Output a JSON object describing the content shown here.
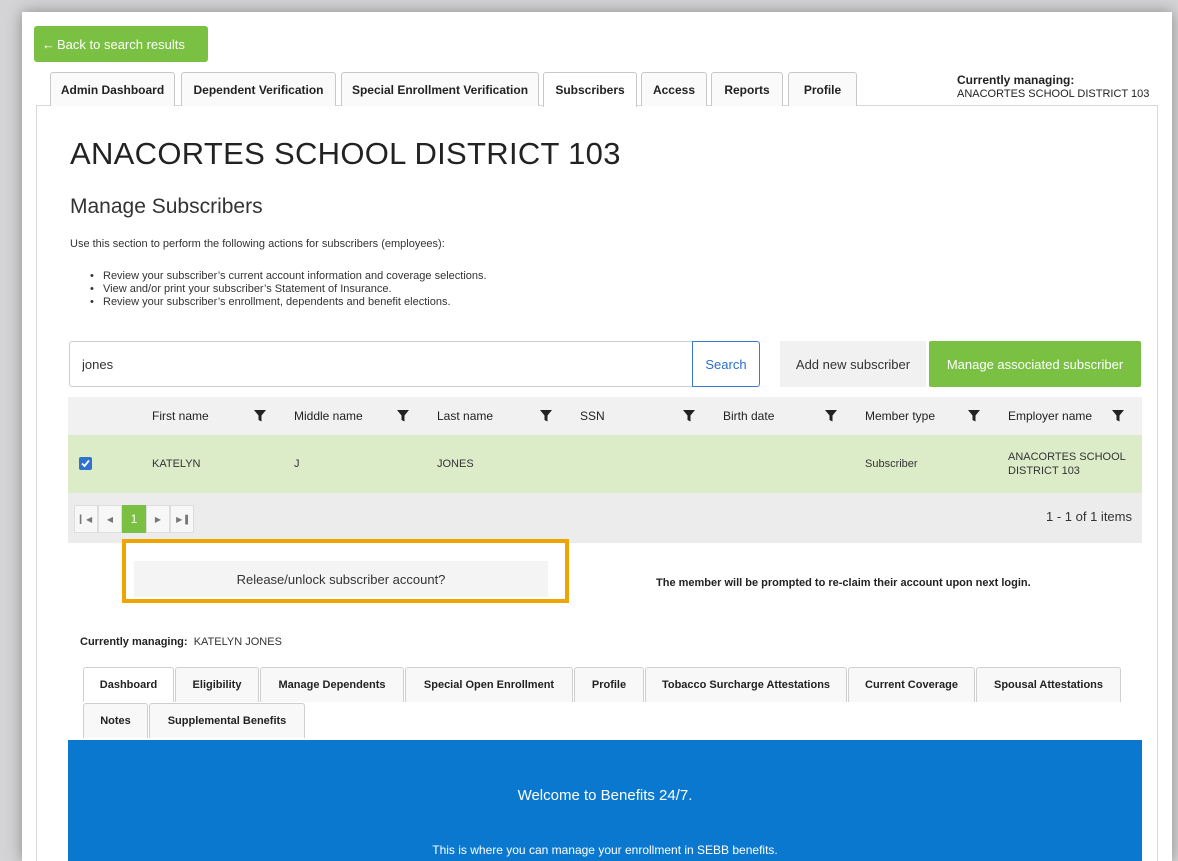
{
  "back_button": {
    "label": "Back to search results",
    "arrow": "←"
  },
  "top_tabs": [
    {
      "label": "Admin Dashboard"
    },
    {
      "label": "Dependent Verification"
    },
    {
      "label": "Special Enrollment Verification"
    },
    {
      "label": "Subscribers",
      "active": true
    },
    {
      "label": "Access"
    },
    {
      "label": "Reports"
    },
    {
      "label": "Profile"
    }
  ],
  "currently_managing_top": {
    "label": "Currently managing:",
    "value": "ANACORTES SCHOOL DISTRICT 103"
  },
  "organization_title": "ANACORTES SCHOOL DISTRICT 103",
  "section": {
    "title": "Manage Subscribers",
    "intro": "Use this section to perform the following actions for subscribers (employees):",
    "bullets": [
      "Review your subscriber’s current account information and coverage selections.",
      "View and/or print your subscriber’s Statement of Insurance.",
      "Review your subscriber’s enrollment, dependents and benefit elections."
    ]
  },
  "search": {
    "value": "jones",
    "button_label": "Search"
  },
  "actions": {
    "add_label": "Add new subscriber",
    "manage_label": "Manage associated subscriber"
  },
  "grid": {
    "columns": [
      "First name",
      "Middle name",
      "Last name",
      "SSN",
      "Birth date",
      "Member type",
      "Employer name"
    ],
    "rows": [
      {
        "checked": true,
        "first": "KATELYN",
        "middle": "J",
        "last": "JONES",
        "ssn": "",
        "birth": "",
        "member_type": "Subscriber",
        "employer_line1": "ANACORTES SCHOOL",
        "employer_line2": "DISTRICT 103"
      }
    ]
  },
  "pager": {
    "current_page": "1",
    "info": "1 - 1 of 1 items"
  },
  "release": {
    "button_label": "Release/unlock subscriber account?",
    "note": "The member will be prompted to re-claim their account upon next login."
  },
  "currently_managing_sub": {
    "label": "Currently managing:",
    "value": "KATELYN JONES"
  },
  "sub_tabs": [
    {
      "label": "Dashboard",
      "active": true
    },
    {
      "label": "Eligibility"
    },
    {
      "label": "Manage Dependents"
    },
    {
      "label": "Special Open Enrollment"
    },
    {
      "label": "Profile"
    },
    {
      "label": "Tobacco Surcharge Attestations"
    },
    {
      "label": "Current Coverage"
    },
    {
      "label": "Spousal Attestations"
    },
    {
      "label": "Notes"
    },
    {
      "label": "Supplemental Benefits"
    }
  ],
  "welcome": {
    "title": "Welcome to Benefits 24/7.",
    "text": "This is where you can manage your enrollment in SEBB benefits."
  },
  "colors": {
    "accent_green": "#7ac143",
    "row_selected": "#dcecc9",
    "welcome_blue": "#0b78cf",
    "highlight_orange": "#f0a400",
    "link_blue": "#2a6fc9"
  },
  "icons": [
    "back-arrow-icon",
    "filter-icon",
    "checkbox-checked-icon",
    "first-page-icon",
    "prev-page-icon",
    "next-page-icon",
    "last-page-icon"
  ]
}
